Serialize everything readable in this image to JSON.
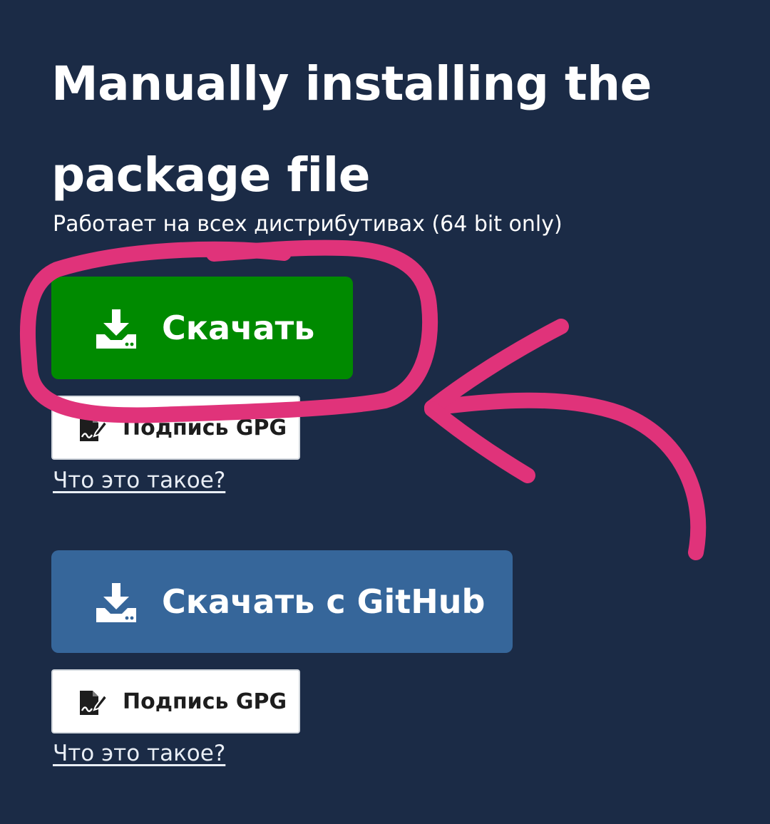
{
  "page": {
    "title": "Manually installing the package file",
    "subtitle": "Работает на всех дистрибутивах (64 bit only)",
    "background_color": "#1b2b46"
  },
  "downloads": [
    {
      "button": {
        "label": "Скачать",
        "icon": "download-icon",
        "color": "#008a00"
      },
      "signature": {
        "label": "Подпись GPG",
        "icon": "signature-file-icon"
      },
      "help_link": "Что это такое?"
    },
    {
      "button": {
        "label": "Скачать с GitHub",
        "icon": "download-icon",
        "color": "#36669a"
      },
      "signature": {
        "label": "Подпись GPG",
        "icon": "signature-file-icon"
      },
      "help_link": "Что это такое?"
    }
  ],
  "annotation": {
    "type": "hand-drawn circle and arrow",
    "color": "#e0337a"
  }
}
